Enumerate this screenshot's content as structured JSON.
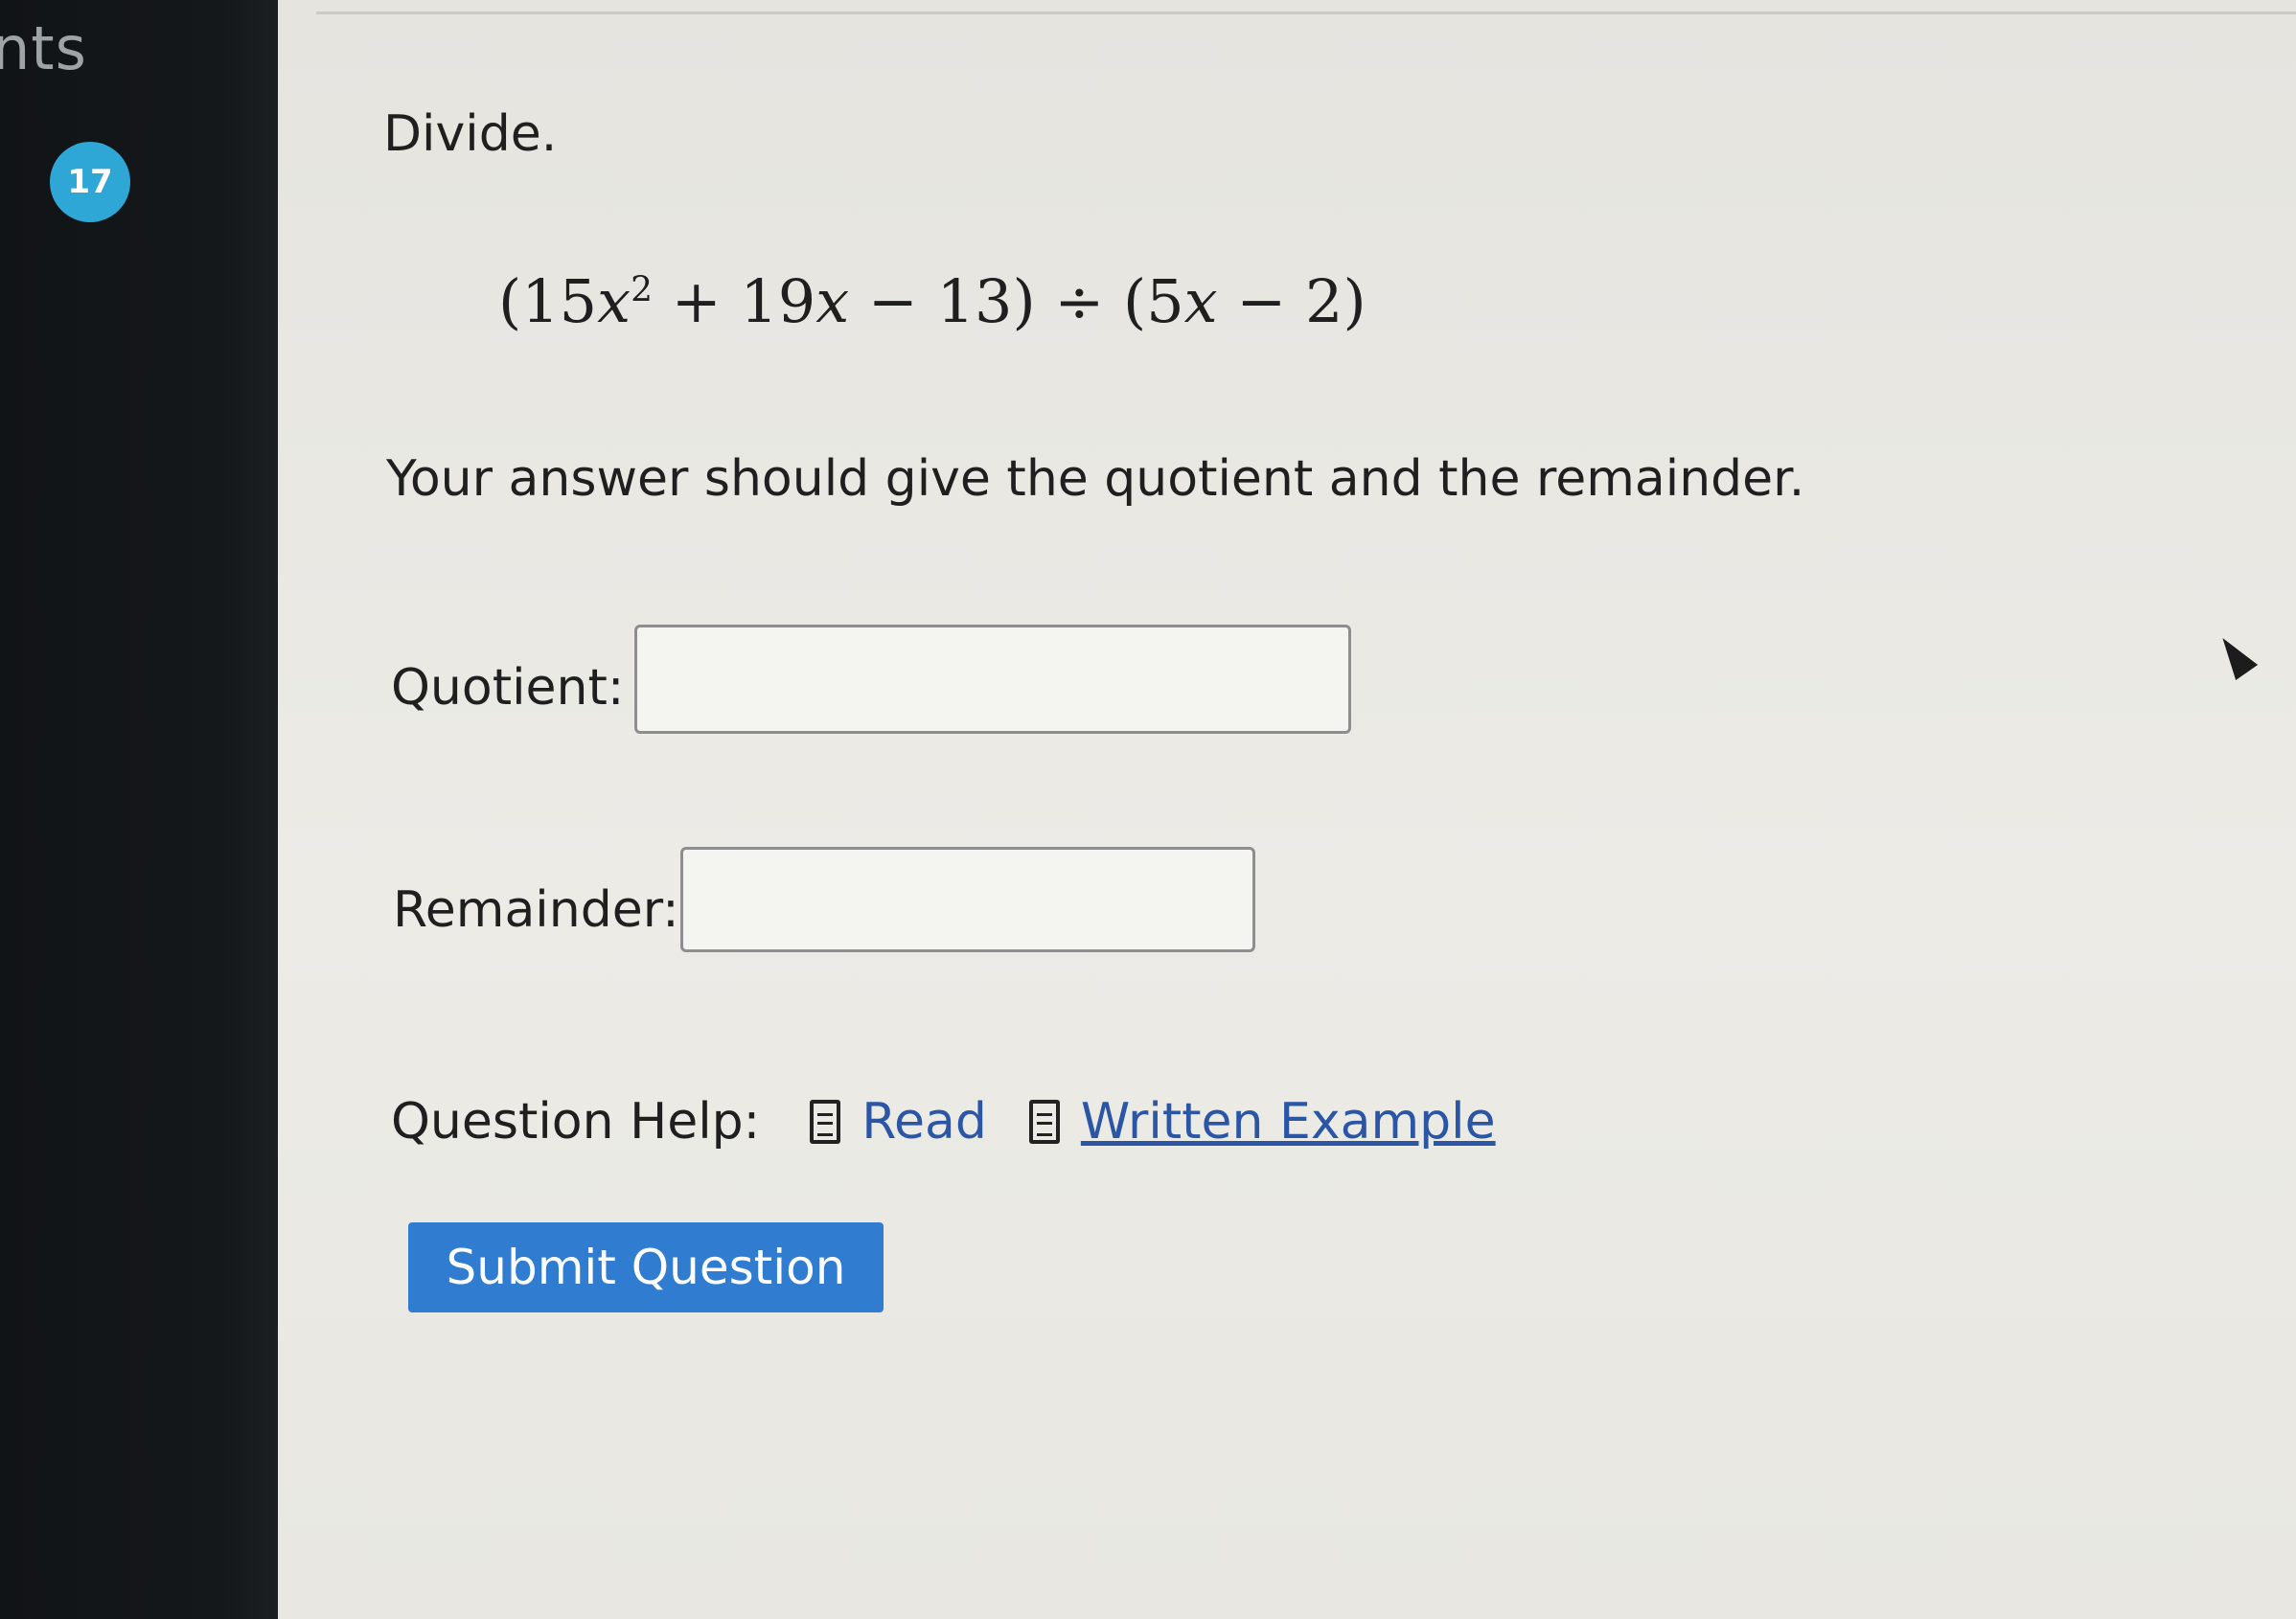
{
  "sidebar": {
    "header_fragment": "nts",
    "question_number": "17"
  },
  "question": {
    "title": "Divide.",
    "expression": {
      "open_paren": "(",
      "coef1": "15",
      "var1": "x",
      "exp1": "2",
      "op1": " + 19",
      "var2": "x",
      "op2": " − 13) ÷ (5",
      "var3": "x",
      "tail": " − 2)"
    },
    "instructions": "Your answer should give the quotient and the remainder."
  },
  "fields": {
    "quotient_label": "Quotient:",
    "quotient_value": "",
    "remainder_label": "Remainder:",
    "remainder_value": ""
  },
  "help": {
    "label": "Question Help:",
    "read_link": "Read",
    "example_link": "Written Example",
    "read_icon": "document-icon",
    "example_icon": "document-icon"
  },
  "submit": {
    "label": "Submit Question"
  },
  "colors": {
    "sidebar_bg": "#14171a",
    "badge": "#2ea7d7",
    "link": "#2a56a5",
    "submit_bg": "#2f7cd1"
  }
}
